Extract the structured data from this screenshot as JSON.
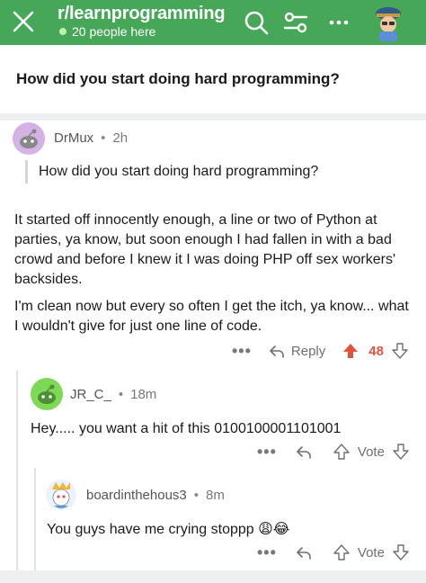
{
  "header": {
    "subreddit": "r/learnprogramming",
    "online": "20 people here"
  },
  "post": {
    "title": "How did you start doing hard programming?"
  },
  "comments": [
    {
      "user": "DrMux",
      "time": "2h",
      "quote": "How did you start doing hard programming?",
      "para1": "It started off innocently enough, a line or two of Python at parties, ya know, but soon enough I had fallen in with a bad crowd and before I knew it I was doing PHP off sex workers' backsides.",
      "para2": "I'm clean now but every so often I get the itch, ya know... what I wouldn't give for just one line of code.",
      "more": "•••",
      "reply_label": "Reply",
      "score": "48"
    },
    {
      "user": "JR_C_",
      "time": "18m",
      "text": "Hey..... you want a hit of this 0100100001101001",
      "more": "•••",
      "vote_label": "Vote"
    },
    {
      "user": "boardinthehous3",
      "time": "8m",
      "text": "You guys have me crying stoppp 😩😂",
      "more": "•••",
      "vote_label": "Vote"
    }
  ],
  "colors": {
    "header_bg": "#46a758",
    "upvote_active": "#e2533d"
  }
}
